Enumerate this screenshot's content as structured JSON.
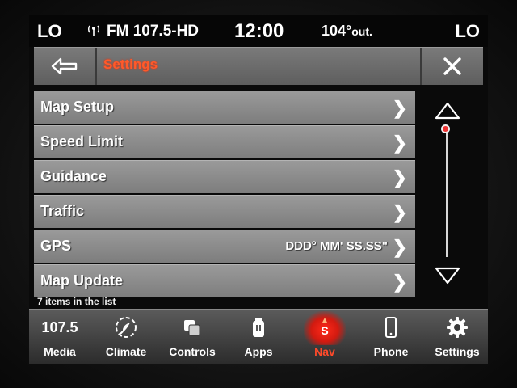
{
  "status": {
    "lo_left": "LO",
    "radio": "FM 107.5-HD",
    "clock": "12:00",
    "temp_value": "104°",
    "temp_unit": "out.",
    "lo_right": "LO"
  },
  "header": {
    "title": "Settings"
  },
  "list": {
    "items": [
      {
        "label": "Map Setup",
        "value": ""
      },
      {
        "label": "Speed Limit",
        "value": ""
      },
      {
        "label": "Guidance",
        "value": ""
      },
      {
        "label": "Traffic",
        "value": ""
      },
      {
        "label": "GPS",
        "value": "DDD° MM' SS.SS\""
      },
      {
        "label": "Map Update",
        "value": ""
      }
    ],
    "count_text": "7 items in the list"
  },
  "nav": {
    "media_value": "107.5",
    "items": [
      {
        "label": "Media"
      },
      {
        "label": "Climate"
      },
      {
        "label": "Controls"
      },
      {
        "label": "Apps"
      },
      {
        "label": "Nav"
      },
      {
        "label": "Phone"
      },
      {
        "label": "Settings"
      }
    ],
    "nav_icon_letter": "S",
    "active": "Nav"
  },
  "colors": {
    "accent": "#ff5a2a",
    "active_glow": "#e2231a"
  }
}
